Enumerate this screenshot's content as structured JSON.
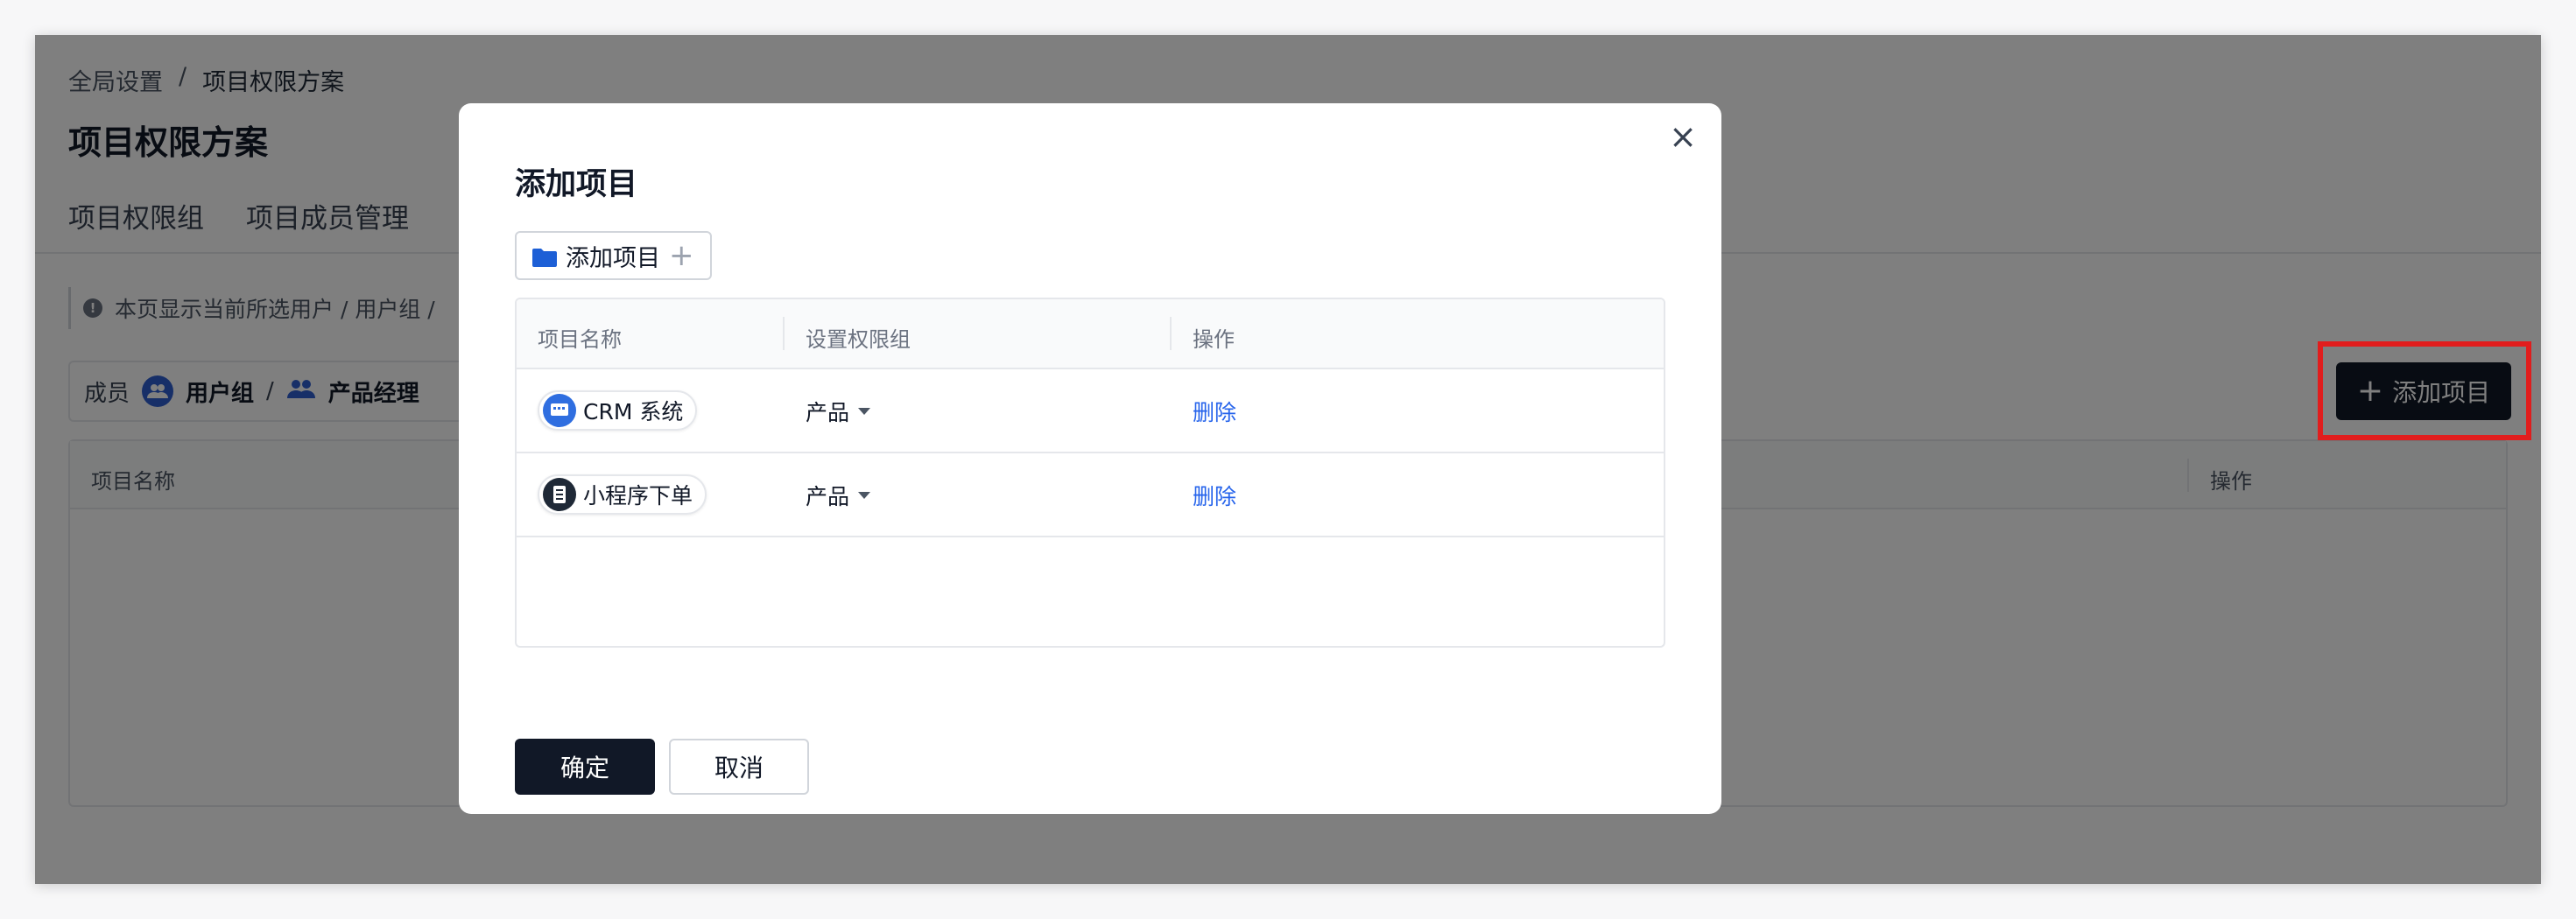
{
  "background": {
    "breadcrumb": {
      "root": "全局设置",
      "separator": "/",
      "current": "项目权限方案"
    },
    "page_title": "项目权限方案",
    "tabs": [
      "项目权限组",
      "项目成员管理"
    ],
    "notice": "本页显示当前所选用户 / 用户组 /",
    "member_bar": {
      "label": "成员",
      "group_label": "用户组",
      "separator": "/",
      "role_label": "产品经理"
    },
    "add_button": {
      "label": "添加项目",
      "plus": "+"
    },
    "table": {
      "col_name": "项目名称",
      "col_action": "操作"
    }
  },
  "modal": {
    "title": "添加项目",
    "close": "×",
    "pick_button": {
      "label": "添加项目",
      "plus": "+"
    },
    "table": {
      "headers": [
        "项目名称",
        "设置权限组",
        "操作"
      ],
      "rows": [
        {
          "project": "CRM 系统",
          "permission_group": "产品",
          "action": "删除",
          "icon_color": "#2f6ee0"
        },
        {
          "project": "小程序下单",
          "permission_group": "产品",
          "action": "删除",
          "icon_color": "#1f2937"
        }
      ]
    },
    "confirm": "确定",
    "cancel": "取消"
  },
  "colors": {
    "primary_dark": "#111827",
    "link_blue": "#2563eb",
    "highlight_red": "#e11d1d"
  }
}
